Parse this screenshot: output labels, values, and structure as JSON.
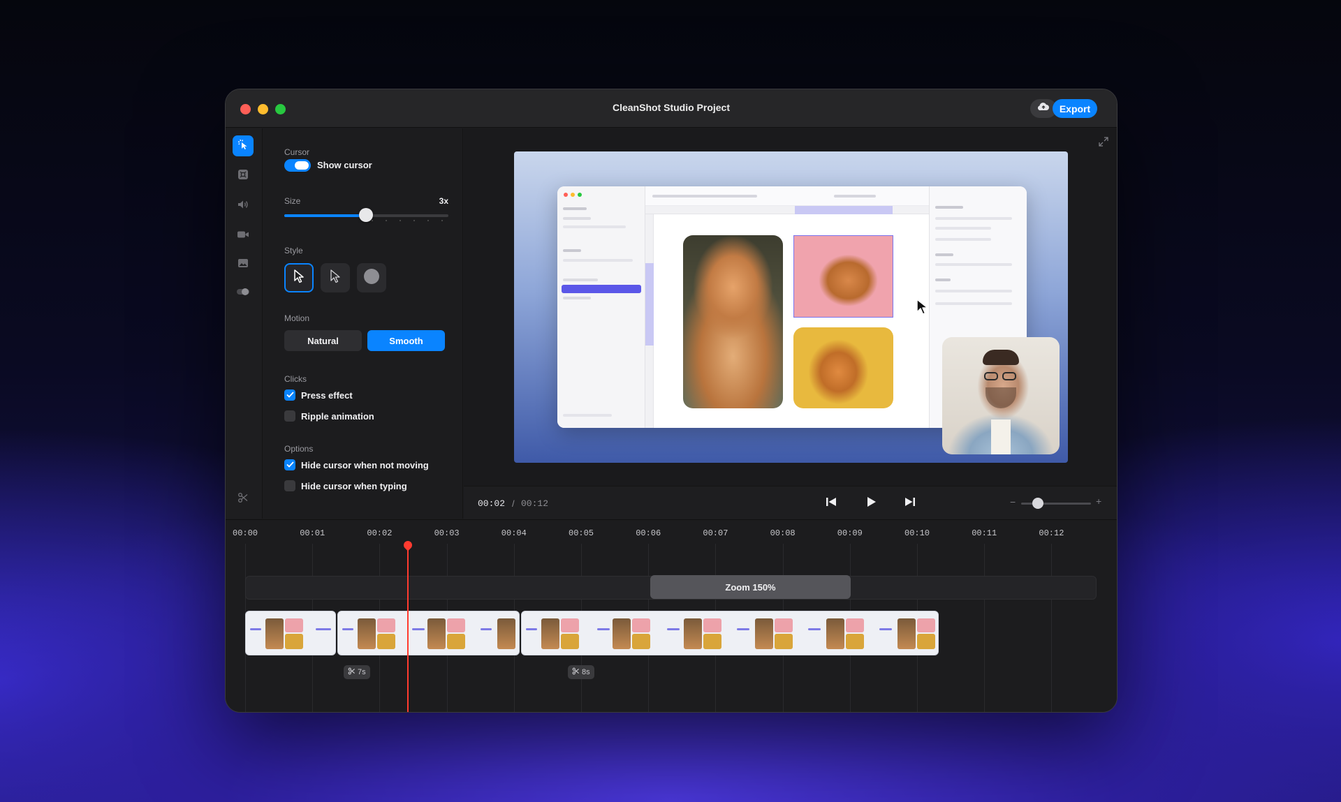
{
  "window": {
    "title": "CleanShot Studio Project",
    "export_label": "Export",
    "cloud_icon": "cloud-upload-icon"
  },
  "toolrail": {
    "items": [
      {
        "name": "cursor",
        "icon": "cursor-click-icon",
        "active": true
      },
      {
        "name": "keyboard",
        "icon": "command-key-icon",
        "active": false
      },
      {
        "name": "audio",
        "icon": "speaker-icon",
        "active": false
      },
      {
        "name": "camera",
        "icon": "video-camera-icon",
        "active": false
      },
      {
        "name": "background",
        "icon": "image-icon",
        "active": false
      },
      {
        "name": "effects",
        "icon": "toggle-icon",
        "active": false
      }
    ],
    "bottom_icon": "scissors-icon"
  },
  "panel": {
    "cursor": {
      "heading": "Cursor",
      "show_cursor_label": "Show cursor",
      "show_cursor": true
    },
    "size": {
      "heading": "Size",
      "value_label": "3x",
      "level": 0.5
    },
    "style": {
      "heading": "Style",
      "options": [
        "arrow-outline",
        "arrow-dark",
        "circle"
      ],
      "selected": 0
    },
    "motion": {
      "heading": "Motion",
      "options": [
        "Natural",
        "Smooth"
      ],
      "selected": "Smooth"
    },
    "clicks": {
      "heading": "Clicks",
      "items": [
        {
          "label": "Press effect",
          "checked": true
        },
        {
          "label": "Ripple animation",
          "checked": false
        }
      ]
    },
    "options": {
      "heading": "Options",
      "items": [
        {
          "label": "Hide cursor when not moving",
          "checked": true
        },
        {
          "label": "Hide cursor when typing",
          "checked": false
        }
      ]
    }
  },
  "transport": {
    "current_time": "00:02",
    "separator": "/",
    "total_time": "00:12",
    "zoom_minus": "−",
    "zoom_plus": "+",
    "zoom_level": 0.2
  },
  "timeline": {
    "ticks": [
      "00:00",
      "00:01",
      "00:02",
      "00:03",
      "00:04",
      "00:05",
      "00:06",
      "00:07",
      "00:08",
      "00:09",
      "00:10",
      "00:11",
      "00:12"
    ],
    "zoom_block_label": "Zoom 150%",
    "cuts": [
      {
        "label": "7s"
      },
      {
        "label": "8s"
      }
    ],
    "playhead_time": "00:02.4"
  },
  "colors": {
    "accent": "#0a84ff",
    "playhead": "#ff3b30",
    "window_bg": "#1c1c1e"
  }
}
